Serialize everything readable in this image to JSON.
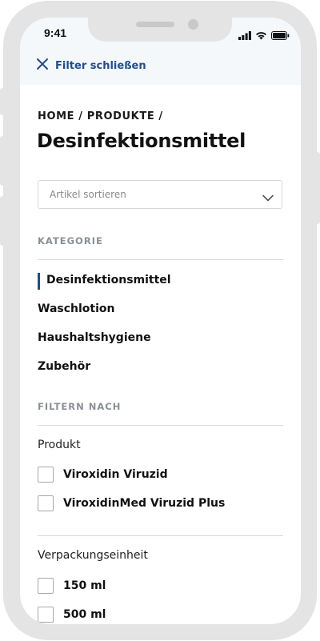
{
  "status_bar": {
    "time": "9:41"
  },
  "header": {
    "close_label": "Filter schließen"
  },
  "breadcrumb": "HOME / PRODUKTE /",
  "page_title": "Desinfektionsmittel",
  "sort": {
    "placeholder": "Artikel sortieren"
  },
  "category": {
    "heading": "KATEGORIE",
    "items": [
      {
        "label": "Desinfektionsmittel",
        "active": true
      },
      {
        "label": "Waschlotion",
        "active": false
      },
      {
        "label": "Haushaltshygiene",
        "active": false
      },
      {
        "label": "Zubehör",
        "active": false
      }
    ]
  },
  "filter": {
    "heading": "FILTERN NACH",
    "groups": [
      {
        "label": "Produkt",
        "options": [
          {
            "label": "Viroxidin Viruzid",
            "checked": false
          },
          {
            "label": "ViroxidinMed Viruzid Plus",
            "checked": false
          }
        ]
      },
      {
        "label": "Verpackungseinheit",
        "options": [
          {
            "label": "150 ml",
            "checked": false
          },
          {
            "label": "500 ml",
            "checked": false
          }
        ]
      }
    ]
  },
  "colors": {
    "accent": "#1f4e8c",
    "device_frame": "#e4e4e4",
    "header_bg": "#f5f8fb",
    "muted_heading": "#8a8f96"
  },
  "icons": {
    "close": "close-icon",
    "chevron": "chevron-down-icon",
    "signal": "signal-icon",
    "wifi": "wifi-icon",
    "battery": "battery-icon"
  }
}
